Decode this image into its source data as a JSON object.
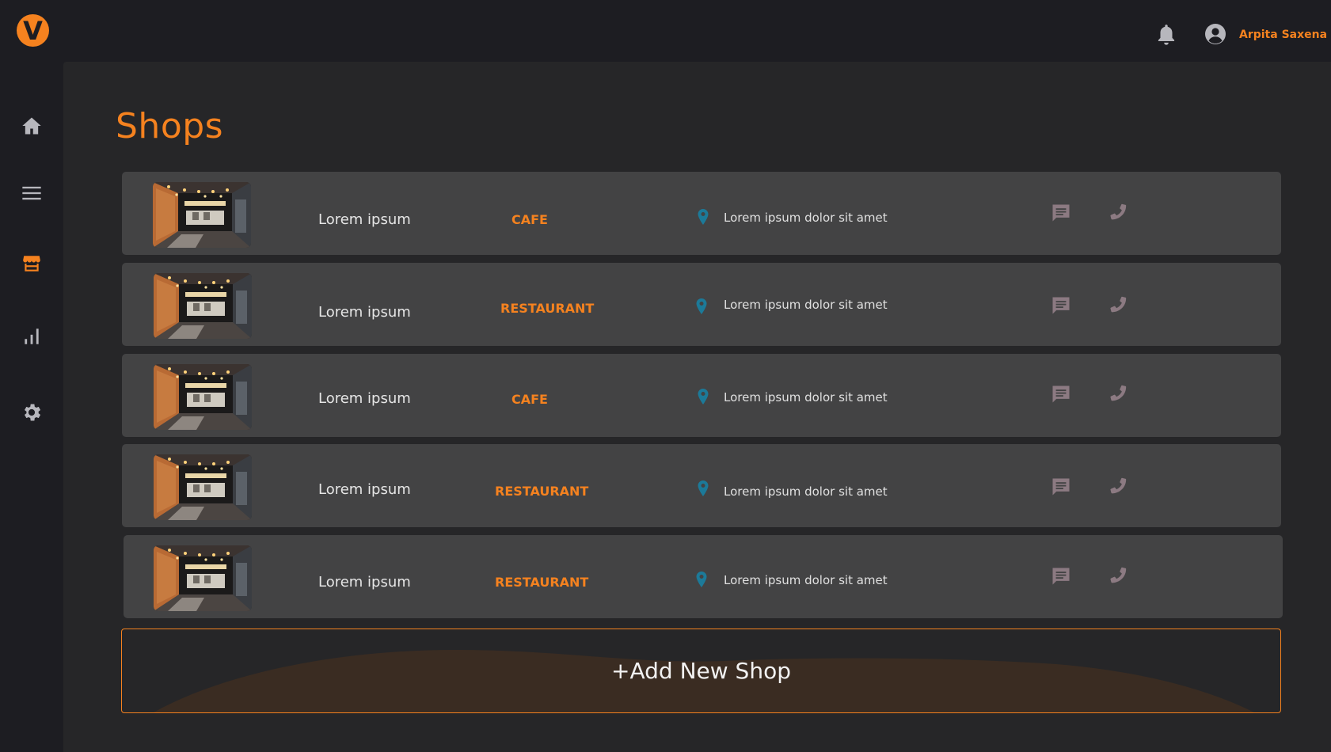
{
  "header": {
    "logo_letter": "V",
    "user_name": "Arpita Saxena"
  },
  "sidebar": {
    "items": [
      {
        "icon": "home-icon",
        "active": false
      },
      {
        "icon": "menu-icon",
        "active": false
      },
      {
        "icon": "store-icon",
        "active": true
      },
      {
        "icon": "bar-chart-icon",
        "active": false
      },
      {
        "icon": "gear-icon",
        "active": false
      }
    ]
  },
  "page": {
    "title": "Shops"
  },
  "shops": [
    {
      "name": "Lorem ipsum",
      "type": "CAFE",
      "address": "Lorem ipsum dolor sit amet"
    },
    {
      "name": "Lorem ipsum",
      "type": "RESTAURANT",
      "address": "Lorem ipsum dolor sit amet"
    },
    {
      "name": "Lorem ipsum",
      "type": "CAFE",
      "address": "Lorem ipsum dolor sit amet"
    },
    {
      "name": "Lorem ipsum",
      "type": "RESTAURANT",
      "address": "Lorem ipsum dolor sit amet"
    },
    {
      "name": "Lorem ipsum",
      "type": "RESTAURANT",
      "address": "Lorem ipsum dolor sit amet"
    }
  ],
  "add_shop": {
    "label": "+Add New Shop"
  },
  "colors": {
    "accent": "#f5821f",
    "background": "#1d1d22",
    "panel": "#262628",
    "row": "#434344",
    "pin": "#1c7a99",
    "action_icon": "#8c7a82"
  }
}
